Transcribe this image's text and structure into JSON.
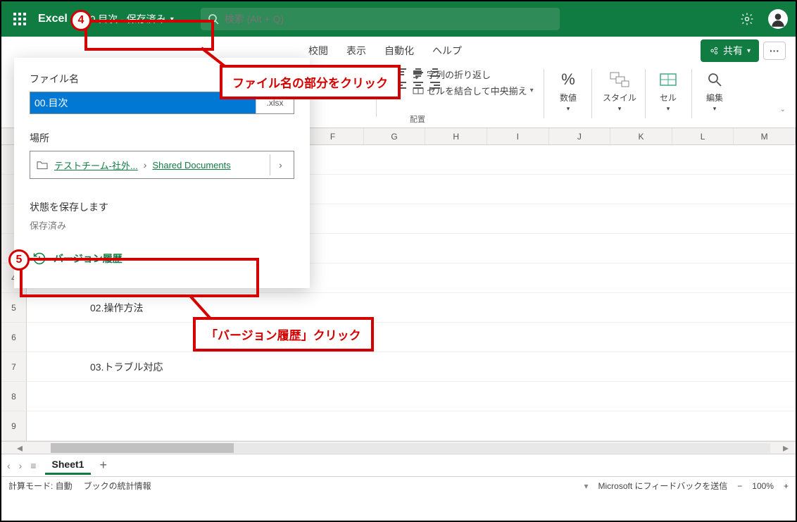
{
  "app": {
    "name": "Excel"
  },
  "file": {
    "display_name": "00.目次",
    "status": "保存済み",
    "title_button": "00.目次 - 保存済み"
  },
  "search": {
    "placeholder": "検索 (Alt + Q)"
  },
  "tabs": {
    "review": "校閲",
    "view": "表示",
    "automate": "自動化",
    "help": "ヘルプ"
  },
  "share": {
    "label": "共有"
  },
  "ribbon": {
    "wrap_text": "字列の折り返し",
    "merge_center": "セルを結合して中央揃え",
    "group_alignment": "配置",
    "number": "数値",
    "styles": "スタイル",
    "cells": "セル",
    "editing": "編集"
  },
  "dropdown": {
    "filename_label": "ファイル名",
    "filename_value": "00.目次",
    "extension": ".xlsx",
    "location_label": "場所",
    "location_team": "テストチーム-社外...",
    "location_folder": "Shared Documents",
    "save_state_label": "状態を保存します",
    "saved_text": "保存済み",
    "version_history": "バージョン履歴"
  },
  "columns": [
    "F",
    "G",
    "H",
    "I",
    "J",
    "K",
    "L",
    "M"
  ],
  "rows": {
    "visible": [
      "4",
      "5",
      "6",
      "7",
      "8",
      "9"
    ],
    "r5_text": "02.操作方法",
    "r7_text": "03.トラブル対応"
  },
  "sheet_tabs": {
    "sheet1": "Sheet1"
  },
  "status": {
    "calc_mode": "計算モード: 自動",
    "workbook_stats": "ブックの統計情報",
    "feedback": "Microsoft にフィードバックを送信",
    "zoom": "100%"
  },
  "annotations": {
    "badge4": "4",
    "badge5": "5",
    "callout1": "ファイル名の部分をクリック",
    "callout2": "「バージョン履歴」クリック"
  }
}
